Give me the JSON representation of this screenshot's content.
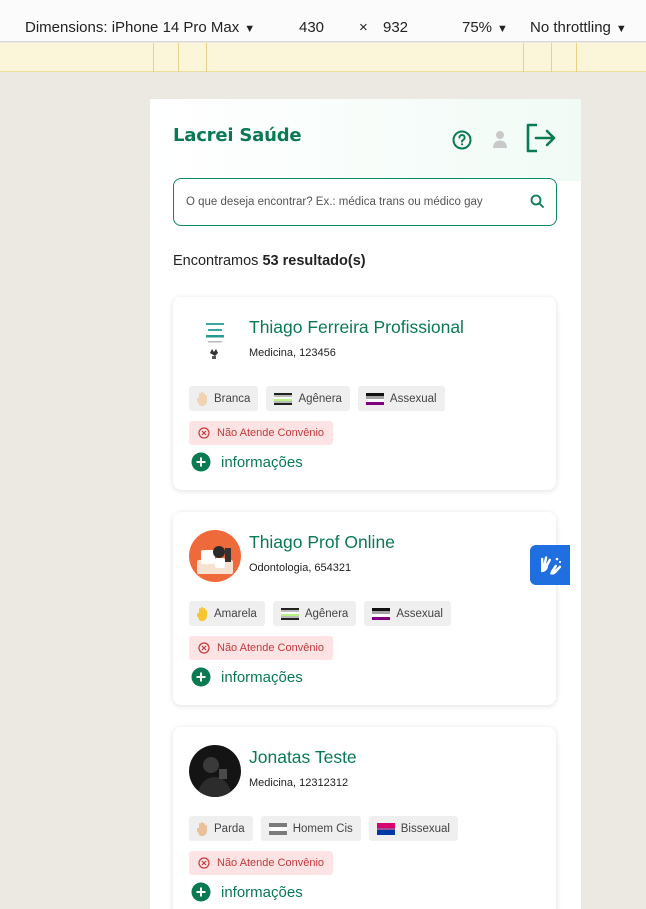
{
  "devtools": {
    "dimensions_label": "Dimensions: iPhone 14 Pro Max",
    "width": "430",
    "times": "×",
    "height": "932",
    "zoom": "75%",
    "throttling": "No throttling"
  },
  "header": {
    "brand": "Lacrei Saúde",
    "icons": [
      "help-icon",
      "user-icon",
      "logout-icon"
    ]
  },
  "search": {
    "placeholder": "O que deseja encontrar? Ex.: médica trans ou médico gay",
    "value": ""
  },
  "results": {
    "prefix": "Encontramos ",
    "count_text": "53 resultado(s)"
  },
  "professionals": [
    {
      "name": "Thiago Ferreira Profissional",
      "specialty": "Medicina, 123456",
      "tags": [
        {
          "label": "Branca",
          "icon": "hand-icon"
        },
        {
          "label": "Agênera",
          "icon": "flag-icon"
        },
        {
          "label": "Assexual",
          "icon": "flag-icon"
        }
      ],
      "warning": "Não Atende Convênio",
      "info_label": "informações"
    },
    {
      "name": "Thiago Prof Online",
      "specialty": "Odontologia, 654321",
      "tags": [
        {
          "label": "Amarela",
          "icon": "hand-icon"
        },
        {
          "label": "Agênera",
          "icon": "flag-icon"
        },
        {
          "label": "Assexual",
          "icon": "flag-icon"
        }
      ],
      "warning": "Não Atende Convênio",
      "info_label": "informações"
    },
    {
      "name": "Jonatas Teste",
      "specialty": "Medicina, 12312312",
      "tags": [
        {
          "label": "Parda",
          "icon": "hand-icon"
        },
        {
          "label": "Homem Cis",
          "icon": "flag-icon"
        },
        {
          "label": "Bissexual",
          "icon": "flag-icon"
        }
      ],
      "warning": "Não Atende Convênio",
      "info_label": "informações"
    }
  ],
  "colors": {
    "brand_green": "#0a7a53",
    "warning_red": "#c33b3b",
    "warning_bg": "#fde3e3",
    "vlibras_blue": "#1f6fe0"
  }
}
